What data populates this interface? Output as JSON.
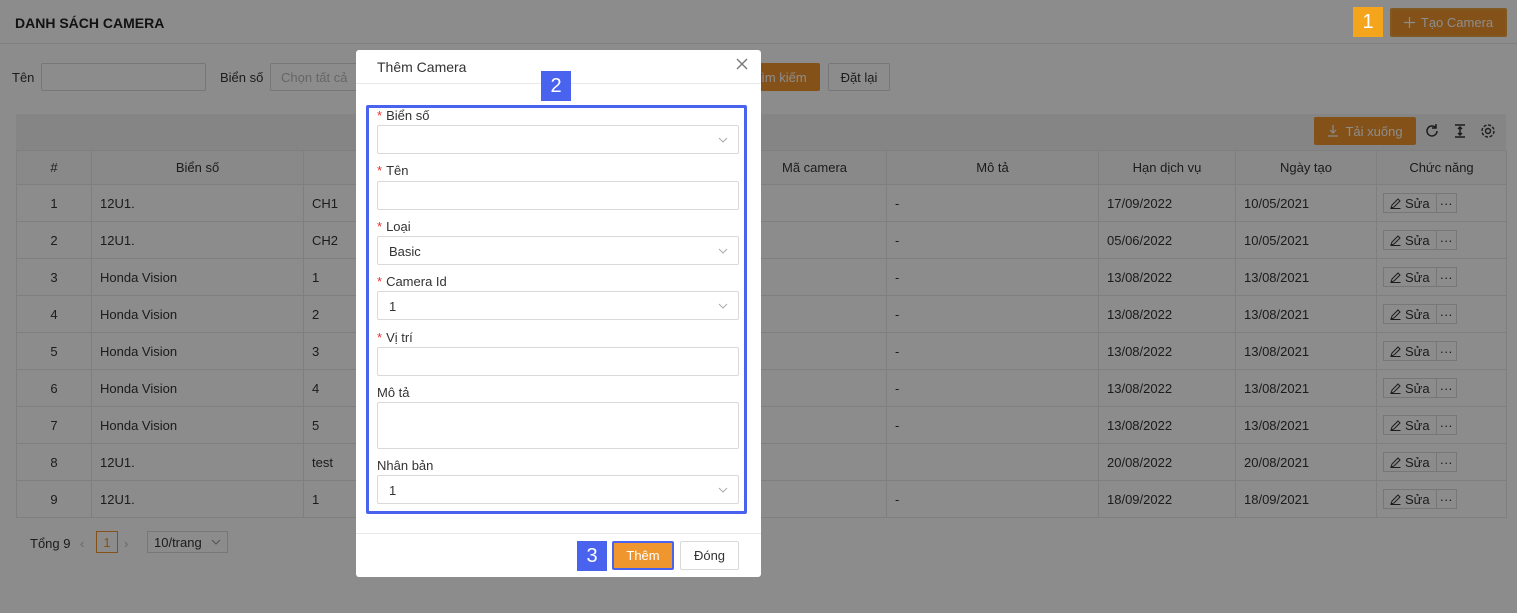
{
  "header": {
    "title": "DANH SÁCH CAMERA",
    "create_label": "Tạo Camera"
  },
  "badges": {
    "one": "1",
    "two": "2",
    "three": "3"
  },
  "filters": {
    "name_label": "Tên",
    "plate_label": "Biển số",
    "plate_placeholder": "Chọn tất cả",
    "search_label": "Tìm kiếm",
    "reset_label": "Đặt lại"
  },
  "toolbar": {
    "download_label": "Tải xuống"
  },
  "table": {
    "columns": [
      "#",
      "Biển số",
      "",
      "Mã camera",
      "Mô tả",
      "Hạn dịch vụ",
      "Ngày tạo",
      "Chức năng"
    ],
    "edit_label": "Sửa",
    "more_label": "···",
    "rows": [
      [
        "1",
        "12U1.",
        "CH1",
        "",
        "-",
        "17/09/2022",
        "10/05/2021"
      ],
      [
        "2",
        "12U1.",
        "CH2",
        "",
        "-",
        "05/06/2022",
        "10/05/2021"
      ],
      [
        "3",
        "Honda Vision",
        "1",
        "",
        "-",
        "13/08/2022",
        "13/08/2021"
      ],
      [
        "4",
        "Honda Vision",
        "2",
        "",
        "-",
        "13/08/2022",
        "13/08/2021"
      ],
      [
        "5",
        "Honda Vision",
        "3",
        "",
        "-",
        "13/08/2022",
        "13/08/2021"
      ],
      [
        "6",
        "Honda Vision",
        "4",
        "",
        "-",
        "13/08/2022",
        "13/08/2021"
      ],
      [
        "7",
        "Honda Vision",
        "5",
        "",
        "-",
        "13/08/2022",
        "13/08/2021"
      ],
      [
        "8",
        "12U1.",
        "test",
        "",
        "",
        "20/08/2022",
        "20/08/2021"
      ],
      [
        "9",
        "12U1.",
        "1",
        "",
        "-",
        "18/09/2022",
        "18/09/2021"
      ]
    ]
  },
  "pagination": {
    "total": "Tổng 9",
    "current": "1",
    "page_size": "10/trang"
  },
  "modal": {
    "title": "Thêm Camera",
    "fields": {
      "plate": {
        "label": "Biển số",
        "value": ""
      },
      "name": {
        "label": "Tên",
        "value": ""
      },
      "type": {
        "label": "Loại",
        "value": "Basic"
      },
      "camera_id": {
        "label": "Camera Id",
        "value": "1"
      },
      "location": {
        "label": "Vị trí",
        "value": ""
      },
      "description": {
        "label": "Mô tả",
        "value": ""
      },
      "clone": {
        "label": "Nhân bản",
        "value": "1"
      }
    },
    "required_mark": "*",
    "add_label": "Thêm",
    "close_label": "Đóng"
  },
  "colors": {
    "accent": "#f0962e",
    "highlight_blue": "#4a63ee",
    "badge_orange": "#f4a51c"
  }
}
